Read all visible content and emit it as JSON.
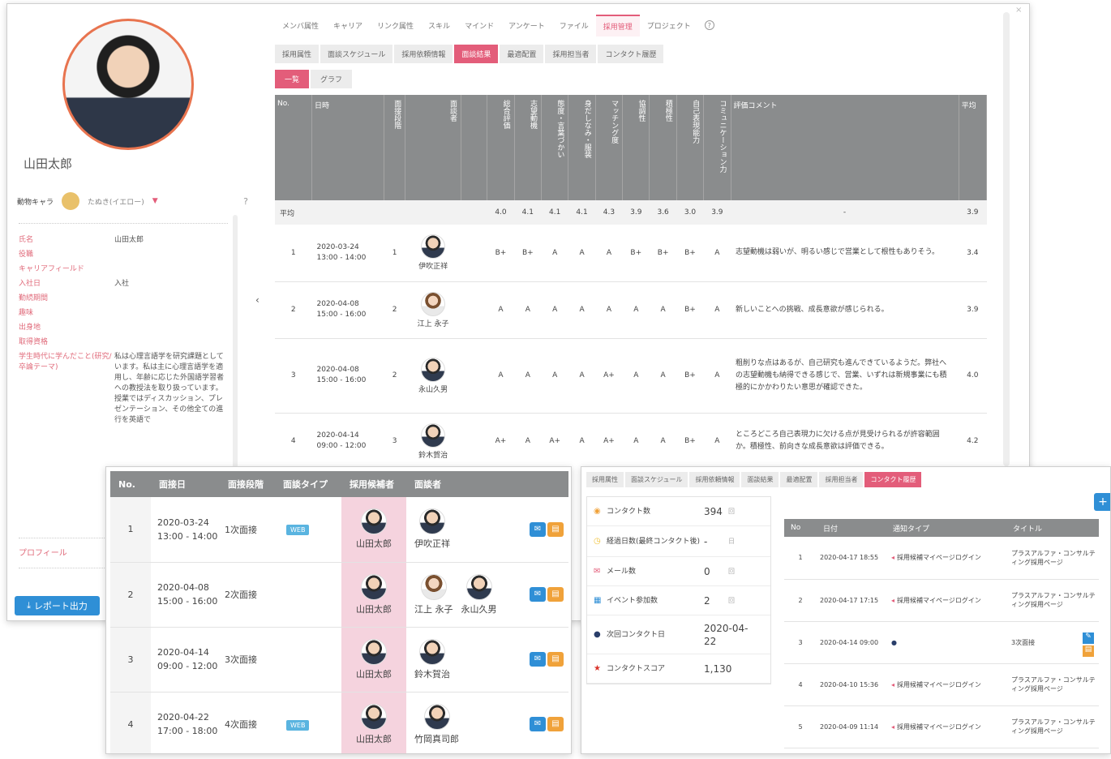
{
  "profile": {
    "name": "山田太郎",
    "animal_label": "動物キャラ",
    "animal_value": "たぬき(イエロー)",
    "fields": [
      {
        "label": "氏名",
        "value": "山田太郎"
      },
      {
        "label": "役職",
        "value": ""
      },
      {
        "label": "キャリアフィールド",
        "value": ""
      },
      {
        "label": "入社日",
        "value": "入社"
      },
      {
        "label": "勤続期間",
        "value": ""
      },
      {
        "label": "趣味",
        "value": ""
      },
      {
        "label": "出身地",
        "value": ""
      },
      {
        "label": "取得資格",
        "value": ""
      },
      {
        "label": "学生時代に学んだこと(研究/卒論テーマ)",
        "value": "私は心理言語学を研究課題としています。私は主に心理言語学を適用し、年齢に応じた外国語学習者への教授法を取り扱っています。授業ではディスカッション、プレゼンテーション、その他全ての進行を英語で"
      }
    ],
    "profile_link": "プロフィール",
    "report_button": "レポート出力"
  },
  "main": {
    "tabs": [
      "メンバ属性",
      "キャリア",
      "リンク属性",
      "スキル",
      "マインド",
      "アンケート",
      "ファイル",
      "採用管理",
      "プロジェクト"
    ],
    "active_tab": "採用管理",
    "subtabs": [
      "採用属性",
      "面談スケジュール",
      "採用依頼情報",
      "面談結果",
      "最適配置",
      "採用担当者",
      "コンタクト履歴"
    ],
    "active_subtab": "面談結果",
    "view_tabs": [
      "一覧",
      "グラフ"
    ],
    "headers": [
      "No.",
      "日時",
      "面接段階",
      "面談者",
      "",
      "総合評価",
      "志望動機",
      "態度・言葉づかい",
      "身だしなみ・服装",
      "マッチング度",
      "協調性",
      "積極性",
      "自己表現能力",
      "コミュニケーション力",
      "評価コメント",
      "平均"
    ],
    "avg_row": {
      "label": "平均",
      "scores": [
        "4.0",
        "4.1",
        "4.1",
        "4.1",
        "4.3",
        "3.9",
        "3.6",
        "3.0",
        "3.9"
      ],
      "comment": "-",
      "avg": "3.9"
    },
    "rows": [
      {
        "no": "1",
        "date": "2020-03-24",
        "time": "13:00 - 14:00",
        "stage": "1",
        "person": "伊吹正祥",
        "scores": [
          "B+",
          "B+",
          "A",
          "A",
          "A",
          "B+",
          "B+",
          "B+",
          "A"
        ],
        "comment": "志望動機は弱いが、明るい感じで営業として根性もありそう。",
        "avg": "3.4"
      },
      {
        "no": "2",
        "date": "2020-04-08",
        "time": "15:00 - 16:00",
        "stage": "2",
        "person": "江上 永子",
        "scores": [
          "A",
          "A",
          "A",
          "A",
          "A",
          "A",
          "A",
          "B+",
          "A"
        ],
        "comment": "新しいことへの挑戦、成長意欲が感じられる。",
        "avg": "3.9"
      },
      {
        "no": "3",
        "date": "2020-04-08",
        "time": "15:00 - 16:00",
        "stage": "2",
        "person": "永山久男",
        "scores": [
          "A",
          "A",
          "A",
          "A",
          "A+",
          "A",
          "A",
          "B+",
          "A"
        ],
        "comment": "粗削りな点はあるが、自己研究も進んできているようだ。弊社への志望動機も納得できる感じで、営業、いずれは新規事業にも積極的にかかわりたい意思が確認できた。",
        "avg": "4.0"
      },
      {
        "no": "4",
        "date": "2020-04-14",
        "time": "09:00 - 12:00",
        "stage": "3",
        "person": "鈴木賀治",
        "scores": [
          "A+",
          "A",
          "A+",
          "A",
          "A+",
          "A",
          "A",
          "B+",
          "A"
        ],
        "comment": "ところどころ自己表現力に欠ける点が見受けられるが許容範囲か。積極性、前向きな成長意欲は評価できる。",
        "avg": "4.2"
      }
    ]
  },
  "schedule": {
    "headers": [
      "No.",
      "面接日",
      "面接段階",
      "面談タイプ",
      "採用候補者",
      "面談者"
    ],
    "web_badge": "WEB",
    "rows": [
      {
        "no": "1",
        "date": "2020-03-24",
        "time": "13:00 - 14:00",
        "stage": "1次面接",
        "web": true,
        "candidate": "山田太郎",
        "interviewers": [
          "伊吹正祥"
        ]
      },
      {
        "no": "2",
        "date": "2020-04-08",
        "time": "15:00 - 16:00",
        "stage": "2次面接",
        "web": false,
        "candidate": "山田太郎",
        "interviewers": [
          "江上 永子",
          "永山久男"
        ]
      },
      {
        "no": "3",
        "date": "2020-04-14",
        "time": "09:00 - 12:00",
        "stage": "3次面接",
        "web": false,
        "candidate": "山田太郎",
        "interviewers": [
          "鈴木賀治"
        ]
      },
      {
        "no": "4",
        "date": "2020-04-22",
        "time": "17:00 - 18:00",
        "stage": "4次面接",
        "web": true,
        "candidate": "山田太郎",
        "interviewers": [
          "竹岡真司郎"
        ]
      }
    ]
  },
  "contact": {
    "subtabs": [
      "採用属性",
      "面談スケジュール",
      "採用依頼情報",
      "面談結果",
      "最適配置",
      "採用担当者",
      "コンタクト履歴"
    ],
    "active_subtab": "コンタクト履歴",
    "stats": [
      {
        "icon": "eye-icon",
        "label": "コンタクト数",
        "value": "394",
        "unit": "回"
      },
      {
        "icon": "clock-icon",
        "label": "経過日数(最終コンタクト後)",
        "value": "-",
        "unit": "日"
      },
      {
        "icon": "mail-icon",
        "label": "メール数",
        "value": "0",
        "unit": "回"
      },
      {
        "icon": "calendar-icon",
        "label": "イベント参加数",
        "value": "2",
        "unit": "回"
      },
      {
        "icon": "person-icon",
        "label": "次回コンタクト日",
        "value": "2020-04-22",
        "unit": ""
      },
      {
        "icon": "star-icon",
        "label": "コンタクトスコア",
        "value": "1,130",
        "unit": ""
      }
    ],
    "headers": [
      "No",
      "日付",
      "通知タイプ",
      "タイトル"
    ],
    "rows": [
      {
        "no": "1",
        "date": "2020-04-17 18:55",
        "type": "採用候補マイページログイン",
        "title": "プラスアルファ・コンサルティング採用ページ"
      },
      {
        "no": "2",
        "date": "2020-04-17 17:15",
        "type": "採用候補マイページログイン",
        "title": "プラスアルファ・コンサルティング採用ページ"
      },
      {
        "no": "3",
        "date": "2020-04-14 09:00",
        "type": "",
        "title": "3次面接"
      },
      {
        "no": "4",
        "date": "2020-04-10 15:36",
        "type": "採用候補マイページログイン",
        "title": "プラスアルファ・コンサルティング採用ページ"
      },
      {
        "no": "5",
        "date": "2020-04-09 11:14",
        "type": "採用候補マイページログイン",
        "title": "プラスアルファ・コンサルティング採用ページ"
      }
    ]
  }
}
